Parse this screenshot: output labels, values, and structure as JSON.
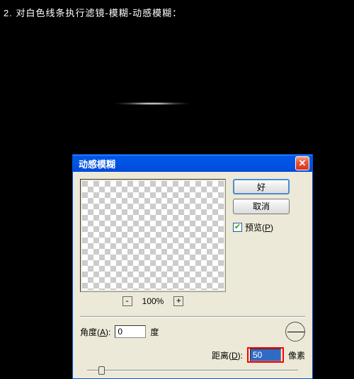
{
  "caption": "2. 对白色线条执行滤镜-模糊-动感模糊：",
  "dialog": {
    "title": "动感模糊",
    "buttons": {
      "ok": "好",
      "cancel": "取消"
    },
    "preview": {
      "label_pre": "预览(",
      "accel": "P",
      "label_post": ")",
      "checked": true
    },
    "zoom": {
      "minus": "-",
      "level": "100%",
      "plus": "+"
    },
    "angle": {
      "label_pre": "角度(",
      "accel": "A",
      "label_post": "):",
      "value": "0",
      "unit": "度"
    },
    "distance": {
      "label_pre": "距离(",
      "accel": "D",
      "label_post": "):",
      "value": "50",
      "unit": "像素"
    }
  }
}
